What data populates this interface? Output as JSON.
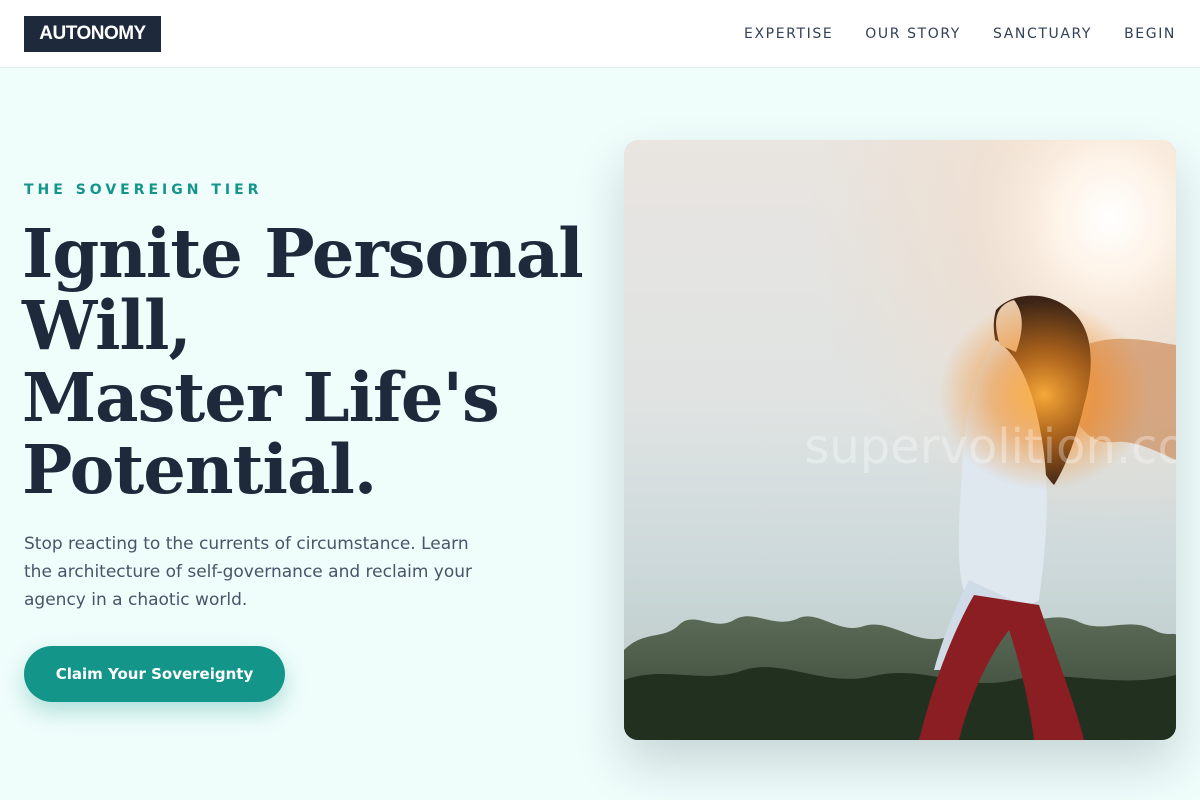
{
  "header": {
    "logo": "AUTONOMY",
    "nav": [
      "EXPERTISE",
      "OUR STORY",
      "SANCTUARY",
      "BEGIN"
    ]
  },
  "hero": {
    "eyebrow": "THE SOVEREIGN TIER",
    "headline": [
      "Ignite Personal",
      "Will,",
      "Master Life's",
      "Potential."
    ],
    "subtext": "Stop reacting to the currents of circumstance. Learn the architecture of self-governance and reclaim your agency in a chaotic world.",
    "cta_label": "Claim Your Sovereignty",
    "image_watermark": "supervolition.com"
  },
  "colors": {
    "accent": "#14958a",
    "text_dark": "#1e293b",
    "page_bg": "#effdfb"
  }
}
